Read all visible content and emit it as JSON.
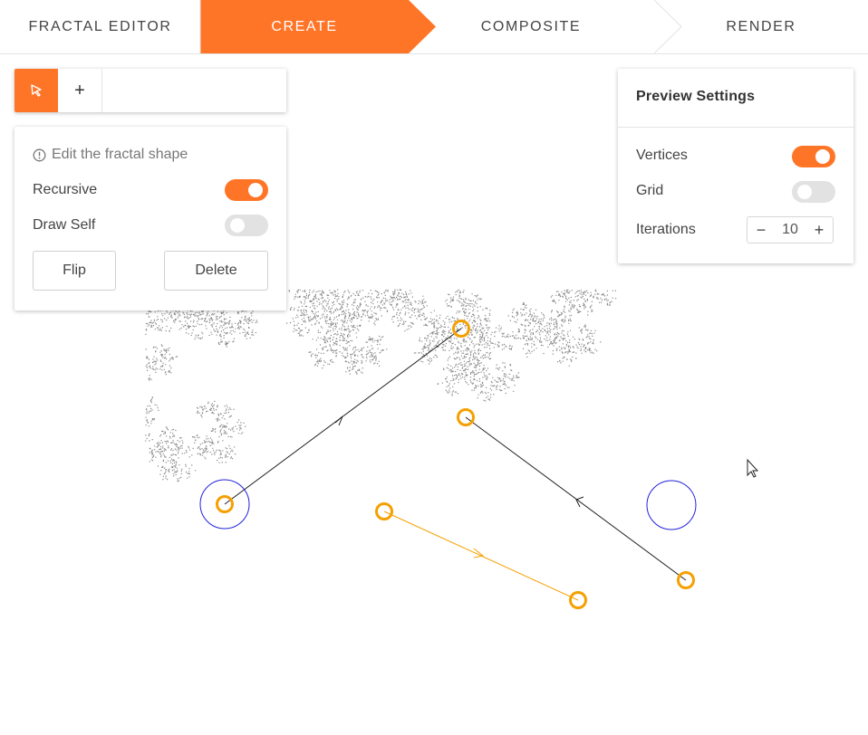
{
  "nav": {
    "tabs": [
      {
        "label": "FRACTAL EDITOR"
      },
      {
        "label": "CREATE"
      },
      {
        "label": "COMPOSITE"
      },
      {
        "label": "RENDER"
      }
    ],
    "active_tab": "CREATE"
  },
  "toolbar": {
    "select_tool_icon": "cursor-arrow-icon",
    "add_tool_label": "+"
  },
  "edit_panel": {
    "hint": "Edit the fractal shape",
    "hint_icon": "info-circle-icon",
    "recursive_label": "Recursive",
    "recursive_on": true,
    "draw_self_label": "Draw Self",
    "draw_self_on": false,
    "flip_label": "Flip",
    "delete_label": "Delete"
  },
  "preview": {
    "title": "Preview Settings",
    "vertices_label": "Vertices",
    "vertices_on": true,
    "grid_label": "Grid",
    "grid_on": false,
    "iterations_label": "Iterations",
    "iterations_value": "10",
    "minus": "−",
    "plus": "+"
  },
  "colors": {
    "accent": "#ff7527",
    "vertex": "#f5a000",
    "anchor": "#2222dd",
    "segment": "#222222"
  }
}
